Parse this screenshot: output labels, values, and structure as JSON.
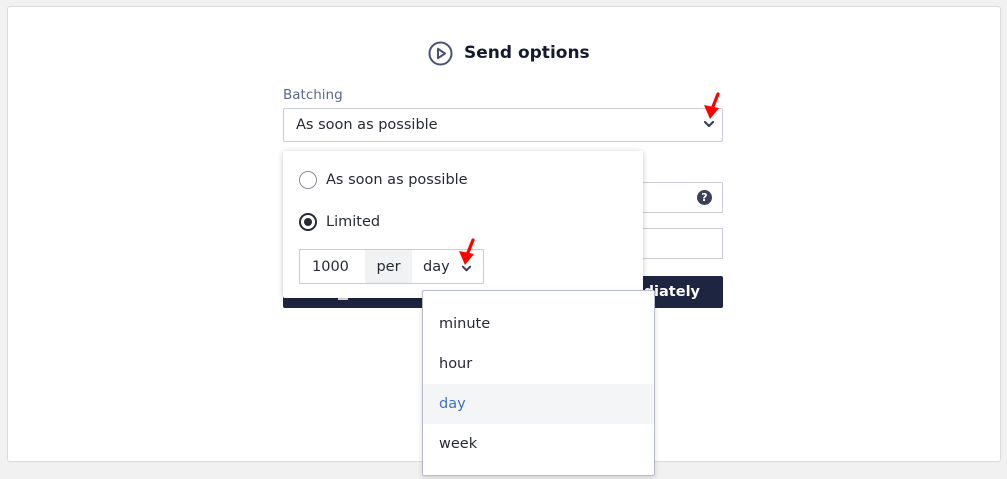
{
  "section": {
    "title": "Send options",
    "icon": "play-circle-icon"
  },
  "batching": {
    "label": "Batching",
    "selected_value": "As soon as possible"
  },
  "popover": {
    "options": [
      {
        "label": "As soon as possible",
        "checked": false
      },
      {
        "label": "Limited",
        "checked": true
      }
    ],
    "rate": {
      "amount": "1000",
      "per_label": "per",
      "unit": "day"
    }
  },
  "background": {
    "help_icon": "?",
    "send_button_partial_label": "diately"
  },
  "unit_dropdown": {
    "options": [
      "minute",
      "hour",
      "day",
      "week"
    ],
    "selected": "day"
  },
  "colors": {
    "annotation_arrow": "#ff0000",
    "selected_option_text": "#3d73c7",
    "primary_button": "#1d2540"
  }
}
